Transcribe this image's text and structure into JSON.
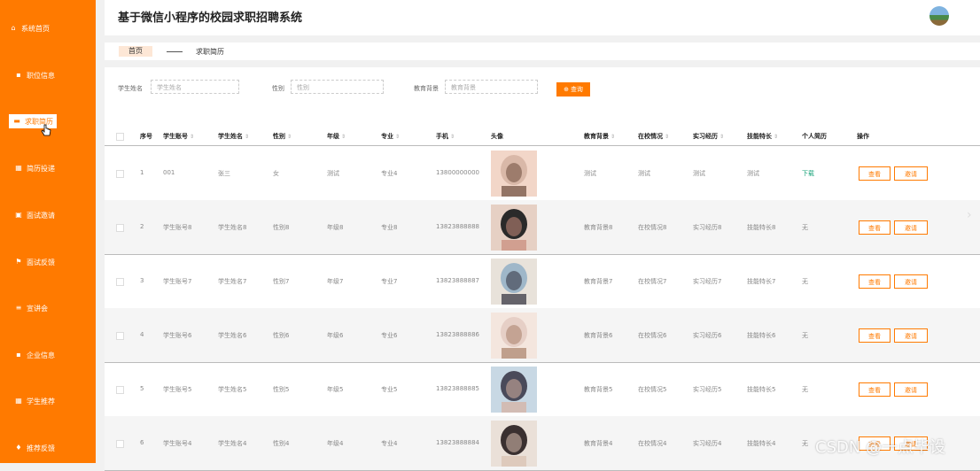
{
  "app": {
    "title": "基于微信小程序的校园求职招聘系统"
  },
  "sidebar": {
    "items": [
      {
        "label": "系统首页",
        "icon": "home-icon"
      },
      {
        "label": "职位信息",
        "icon": "briefcase-icon"
      },
      {
        "label": "求职简历",
        "icon": "message-icon"
      },
      {
        "label": "简历投递",
        "icon": "grid-icon"
      },
      {
        "label": "面试邀请",
        "icon": "mail-icon"
      },
      {
        "label": "面试反馈",
        "icon": "flag-icon"
      },
      {
        "label": "宣讲会",
        "icon": "list-icon"
      },
      {
        "label": "企业信息",
        "icon": "building-icon"
      },
      {
        "label": "学生推荐",
        "icon": "grid-icon"
      },
      {
        "label": "推荐反馈",
        "icon": "trophy-icon"
      }
    ]
  },
  "tabs": {
    "home": "首页",
    "current": "求职简历"
  },
  "search": {
    "name_label": "学生姓名",
    "name_placeholder": "学生姓名",
    "gender_label": "性别",
    "gender_placeholder": "性别",
    "edu_label": "教育背景",
    "edu_placeholder": "教育背景",
    "query_button": "查询"
  },
  "table": {
    "headers": [
      "序号",
      "学生账号",
      "学生姓名",
      "性别",
      "年级",
      "专业",
      "手机",
      "头像",
      "教育背景",
      "在校情况",
      "实习经历",
      "技能特长",
      "个人简历",
      "操作"
    ],
    "rows": [
      {
        "no": "1",
        "account": "001",
        "name": "张三",
        "gender": "女",
        "grade": "测试",
        "major": "专业4",
        "phone": "13800000000",
        "edu": "测试",
        "school": "测试",
        "intern": "测试",
        "skill": "测试",
        "resume": "下载"
      },
      {
        "no": "2",
        "account": "学生账号8",
        "name": "学生姓名8",
        "gender": "性别8",
        "grade": "年级8",
        "major": "专业8",
        "phone": "13823888888",
        "edu": "教育背景8",
        "school": "在校情况8",
        "intern": "实习经历8",
        "skill": "技能特长8",
        "resume": "无"
      },
      {
        "no": "3",
        "account": "学生账号7",
        "name": "学生姓名7",
        "gender": "性别7",
        "grade": "年级7",
        "major": "专业7",
        "phone": "13823888887",
        "edu": "教育背景7",
        "school": "在校情况7",
        "intern": "实习经历7",
        "skill": "技能特长7",
        "resume": "无"
      },
      {
        "no": "4",
        "account": "学生账号6",
        "name": "学生姓名6",
        "gender": "性别6",
        "grade": "年级6",
        "major": "专业6",
        "phone": "13823888886",
        "edu": "教育背景6",
        "school": "在校情况6",
        "intern": "实习经历6",
        "skill": "技能特长6",
        "resume": "无"
      },
      {
        "no": "5",
        "account": "学生账号5",
        "name": "学生姓名5",
        "gender": "性别5",
        "grade": "年级5",
        "major": "专业5",
        "phone": "13823888885",
        "edu": "教育背景5",
        "school": "在校情况5",
        "intern": "实习经历5",
        "skill": "技能特长5",
        "resume": "无"
      },
      {
        "no": "6",
        "account": "学生账号4",
        "name": "学生姓名4",
        "gender": "性别4",
        "grade": "年级4",
        "major": "专业4",
        "phone": "13823888884",
        "edu": "教育背景4",
        "school": "在校情况4",
        "intern": "实习经历4",
        "skill": "技能特长4",
        "resume": "无"
      }
    ],
    "view_button": "查看",
    "invite_button": "邀请"
  },
  "watermark": "CSDN @一点毕设",
  "colors": {
    "accent": "#ff7a00",
    "download": "#1aa37a"
  }
}
